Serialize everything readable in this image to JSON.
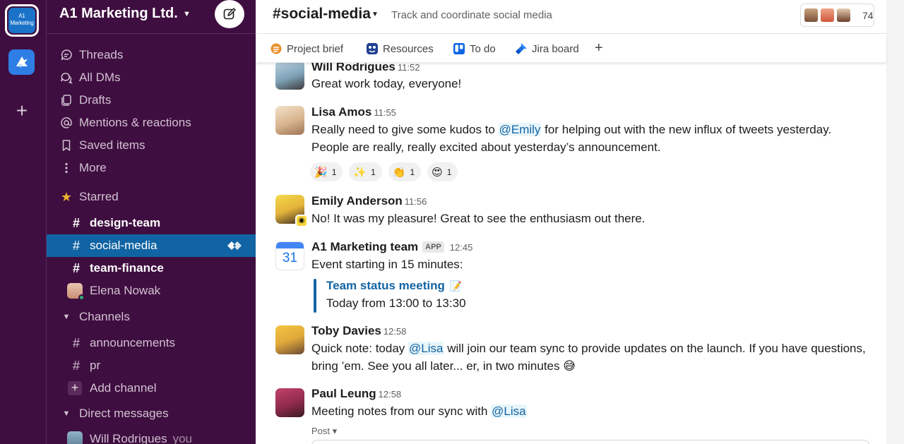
{
  "workspace": {
    "logo_line1": "A1",
    "logo_line2": "Marketing",
    "name": "A1 Marketing Ltd.",
    "caret": "⌄"
  },
  "rail": {
    "add_symbol": "+"
  },
  "nav": [
    {
      "label": "Threads",
      "icon": "threads-icon"
    },
    {
      "label": "All DMs",
      "icon": "dms-icon"
    },
    {
      "label": "Drafts",
      "icon": "drafts-icon"
    },
    {
      "label": "Mentions & reactions",
      "icon": "at-icon"
    },
    {
      "label": "Saved items",
      "icon": "bookmark-icon"
    },
    {
      "label": "More",
      "icon": "more-icon"
    }
  ],
  "starred": {
    "title": "Starred",
    "items": [
      {
        "hash": "#",
        "label": "design-team"
      },
      {
        "hash": "#",
        "label": "social-media"
      },
      {
        "hash": "#",
        "label": "team-finance"
      },
      {
        "label": "Elena Nowak"
      }
    ]
  },
  "channels": {
    "title": "Channels",
    "items": [
      {
        "hash": "#",
        "label": "announcements"
      },
      {
        "hash": "#",
        "label": "pr"
      }
    ],
    "add_label": "Add channel",
    "add_symbol": "+"
  },
  "dms": {
    "title": "Direct messages",
    "items": [
      {
        "label": "Will Rodrigues",
        "suffix": "you"
      }
    ]
  },
  "channel": {
    "name": "#social-media",
    "caret": "⌄",
    "topic": "Track and coordinate social media",
    "member_count": "74"
  },
  "tabs": [
    {
      "label": "Project brief",
      "icon": "canvas-icon"
    },
    {
      "label": "Resources",
      "icon": "resources-icon"
    },
    {
      "label": "To do",
      "icon": "trello-icon"
    },
    {
      "label": "Jira board",
      "icon": "jira-icon"
    }
  ],
  "tab_add": "+",
  "messages": [
    {
      "author": "Will Rodrigues",
      "time": "11:52",
      "lines": [
        "Great work today, everyone!"
      ]
    },
    {
      "author": "Lisa Amos",
      "time": "11:55",
      "line1_pre": "Really need to give some kudos to ",
      "line1_mention": "@Emily",
      "line1_post": " for helping out with the new influx of tweets yesterday.",
      "line2": "People are really, really excited about yesterday’s announcement.",
      "reactions": [
        {
          "emoji": "🎉",
          "count": "1"
        },
        {
          "emoji": "✨",
          "count": "1"
        },
        {
          "emoji": "👏",
          "count": "1"
        },
        {
          "emoji": "😍",
          "count": "1"
        }
      ]
    },
    {
      "author": "Emily Anderson",
      "time": "11:56",
      "lines": [
        "No! It was my pleasure! Great to see the enthusiasm out there."
      ]
    },
    {
      "author": "A1 Marketing team",
      "badge": "APP",
      "time": "12:45",
      "calendar_day": "31",
      "lines": [
        "Event starting in 15 minutes:"
      ],
      "quote_title": "Team status meeting",
      "quote_emoji": "📝",
      "quote_text": "Today from 13:00 to 13:30"
    },
    {
      "author": "Toby Davies",
      "time": "12:58",
      "line1_pre": "Quick note: today ",
      "line1_mention": "@Lisa",
      "line1_post": " will join our team sync to provide updates on the launch. If you have questions,",
      "line2": "bring ’em. See you all later... er, in two minutes 😅"
    },
    {
      "author": "Paul Leung",
      "time": "12:58",
      "line1_pre": "Meeting notes from our sync with ",
      "line1_mention": "@Lisa",
      "post_label": "Post ▾"
    }
  ],
  "colors": {
    "sidebar_bg": "#3f0e40",
    "active_channel": "#1164a3",
    "link": "#1264a3",
    "presence": "#2bac76"
  }
}
